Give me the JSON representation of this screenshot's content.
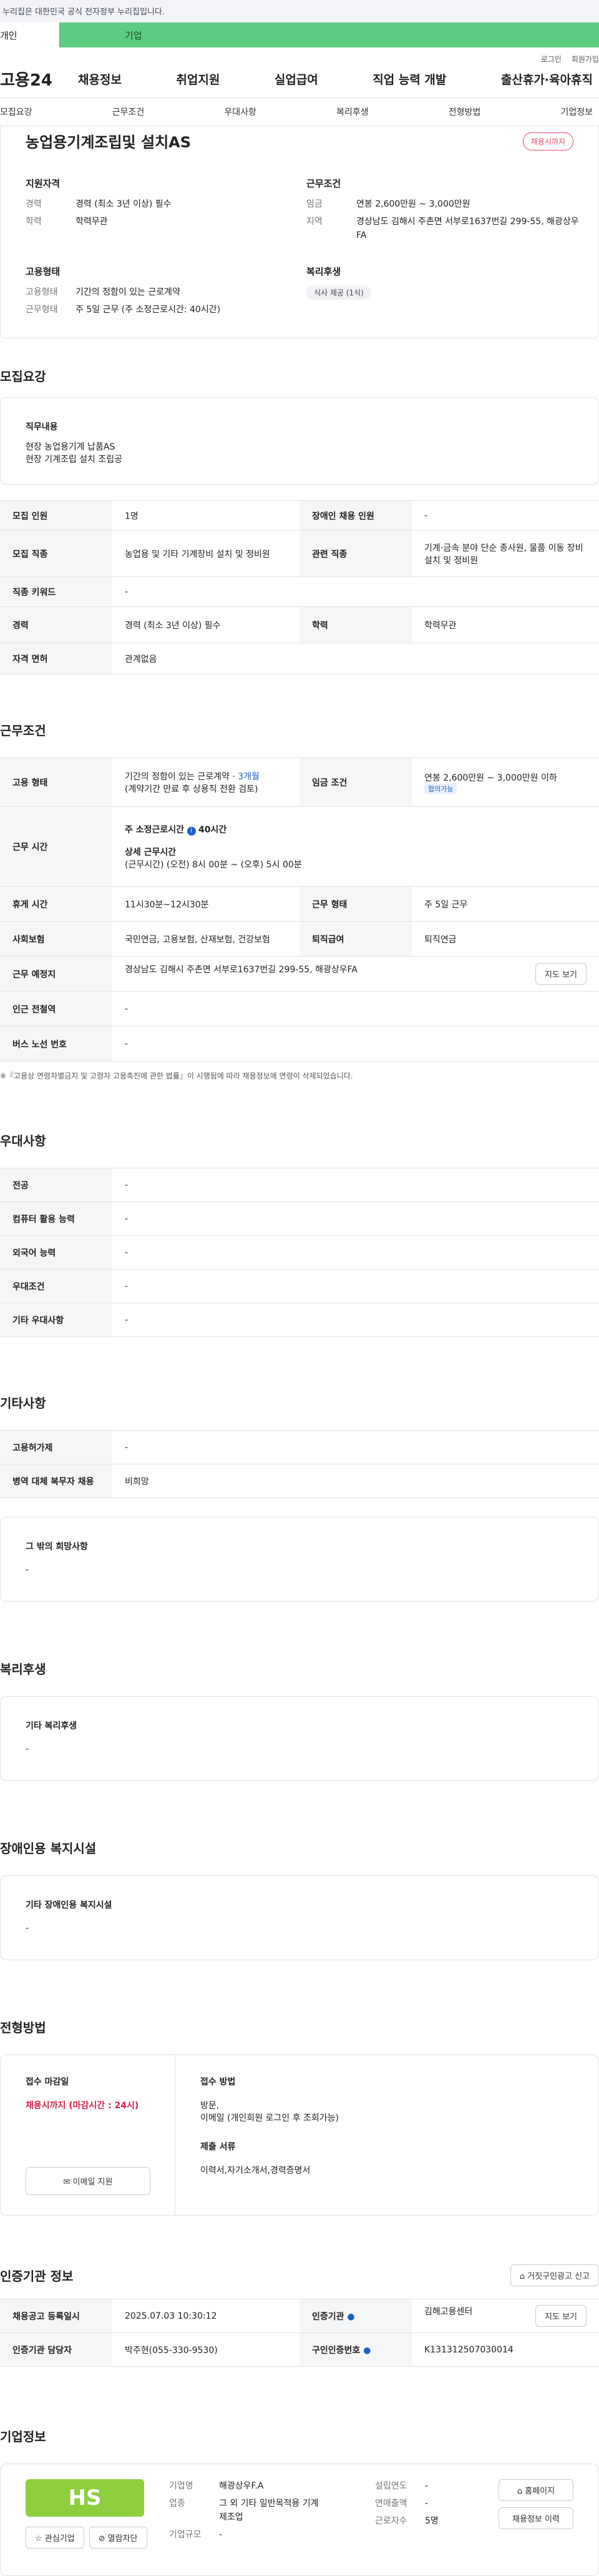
{
  "topbar": {
    "notice": "이 누리집은 대한민국 공식 전자정부 누리집입니다."
  },
  "tabs": {
    "personal": "개인",
    "corporate": "기업"
  },
  "util": {
    "login": "로그인",
    "signup": "회원가입"
  },
  "gnb": {
    "logo": "고용24",
    "items": [
      "채용정보",
      "취업지원",
      "실업급여",
      "직업 능력 개발",
      "출산휴가·육아휴직"
    ]
  },
  "subnav": {
    "items": [
      "모집요강",
      "근무조건",
      "우대사항",
      "복리후생",
      "전형방법",
      "기업정보"
    ]
  },
  "job": {
    "title": "농업용기계조립및 설치AS",
    "status": "채용시까지",
    "qual_title": "지원자격",
    "exp_label": "경력",
    "exp": "경력 (최소 3년 이상) 필수",
    "edu_label": "학력",
    "edu": "학력무관",
    "emp_title": "고용형태",
    "emptype_label": "고용형태",
    "emptype": "기간의 정함이 있는 근로계약",
    "worktype_label": "근무형태",
    "worktype": "주 5일 근무 (주 소정근로시간: 40시간)",
    "cond_title": "근무조건",
    "wage_label": "임금",
    "wage": "연봉 2,600만원 ~ 3,000만원",
    "region_label": "지역",
    "region": "경상남도 김해시 주촌면 서부로1637번길 299-55, 해광상우FA",
    "welfare_title": "복리후생",
    "welfare_chip": "식사 제공 (1식)"
  },
  "recruit": {
    "title": "모집요강",
    "duty_title": "직무내용",
    "duty1": "현장 농업용기계 납품AS",
    "duty2": "현장 기계조립 설치 조립공",
    "rows": {
      "count_l": "모집 인원",
      "count": "1명",
      "disabled_l": "장애인 채용 인원",
      "disabled": "-",
      "job_l": "모집 직종",
      "job": "농업용 및 기타 기계장비 설치 및 정비원",
      "rel_l": "관련 직종",
      "rel": "기계·금속 분야 단순 종사원, 물품 이동 장비 설치 및 정비원",
      "kw_l": "직종 키워드",
      "kw": "-",
      "exp_l": "경력",
      "exp": "경력 (최소 3년 이상) 필수",
      "edu_l": "학력",
      "edu": "학력무관",
      "lic_l": "자격 면허",
      "lic": "관계없음"
    }
  },
  "work": {
    "title": "근무조건",
    "emp_l": "고용 형태",
    "emp1": "기간의 정함이 있는 근로계약 · ",
    "emp_months": "3개월",
    "emp2": "(계약기간 만료 후 상용직 전환 검토)",
    "wage_l": "임금 조건",
    "wage": "연봉 2,600만원 ~ 3,000만원 이하",
    "wage_chip": "협의가능",
    "time_l": "근무 시간",
    "time1": "주 소정근로시간",
    "time1v": "40시간",
    "time2": "상세 근무시간",
    "time3": "(근무시간) (오전) 8시 00분 ~ (오후) 5시 00분",
    "rest_l": "휴게 시간",
    "rest": "11시30분~12시30분",
    "form_l": "근무 형태",
    "form": "주 5일 근무",
    "ins_l": "사회보험",
    "ins": "국민연금, 고용보험, 산재보험, 건강보험",
    "ret_l": "퇴직급여",
    "ret": "퇴직연금",
    "place_l": "근무 예정지",
    "place": "경상남도 김해시 주촌면 서부로1637번길 299-55, 해광상우FA",
    "map_btn": "지도 보기",
    "sub_l": "인근 전철역",
    "sub": "-",
    "bus_l": "버스 노선 번호",
    "bus": "-",
    "note": "※『고용상 연령차별금지 및 고령자 고용촉진에 관한 법률』이 시행됨에 따라 채용정보에 연령이 삭제되었습니다."
  },
  "pref": {
    "title": "우대사항",
    "r": [
      [
        "전공",
        "-"
      ],
      [
        "컴퓨터 활용 능력",
        "-"
      ],
      [
        "외국어 능력",
        "-"
      ],
      [
        "우대조건",
        "-"
      ],
      [
        "기타 우대사항",
        "-"
      ]
    ]
  },
  "etc": {
    "title": "기타사항",
    "r": [
      [
        "고용허가제",
        "-"
      ],
      [
        "병역 대체 복무자 채용",
        "비희망"
      ]
    ],
    "other_title": "그 밖의 희망사항",
    "other": "-"
  },
  "benefit": {
    "title": "복리후생",
    "sub": "기타 복리후생",
    "val": "-"
  },
  "facility": {
    "title": "장애인용 복지시설",
    "sub": "기타 장애인용 복지시설",
    "val": "-"
  },
  "selection": {
    "title": "전형방법",
    "deadline_t": "접수 마감일",
    "deadline": "채용시까지 (마감시간 : 24시)",
    "email_btn": "이메일 지원",
    "method_t": "접수 방법",
    "method1": "방문,",
    "method2": "이메일 (개인회원 로그인 후 조회가능)",
    "docs_t": "제출 서류",
    "docs": "이력서,자기소개서,경력증명서"
  },
  "cert": {
    "title": "인증기관 정보",
    "report_btn": "거짓구인광고 신고",
    "reg_l": "채용공고 등록일시",
    "reg": "2025.07.03 10:30:12",
    "org_l": "인증기관",
    "org": "김해고용센터",
    "map_btn": "지도 보기",
    "mgr_l": "인증기관 담당자",
    "mgr": "박주현(055-330-9530)",
    "no_l": "구인인증번호",
    "no": "K131312507030014"
  },
  "company": {
    "title": "기업정보",
    "logo_text": "HS",
    "fav_btn": "관심기업",
    "block_btn": "열람차단",
    "name_l": "기업명",
    "name": "해광상우F.A",
    "year_l": "설립연도",
    "year": "-",
    "ind_l": "업종",
    "ind": "그 외 기타 일반목적용 기계 제조업",
    "sales_l": "연매출액",
    "sales": "-",
    "emp_l": "근로자수",
    "emp": "5명",
    "size_l": "기업규모",
    "size": "-",
    "home_btn": "홈페이지",
    "hist_btn": "채용정보 이력"
  }
}
